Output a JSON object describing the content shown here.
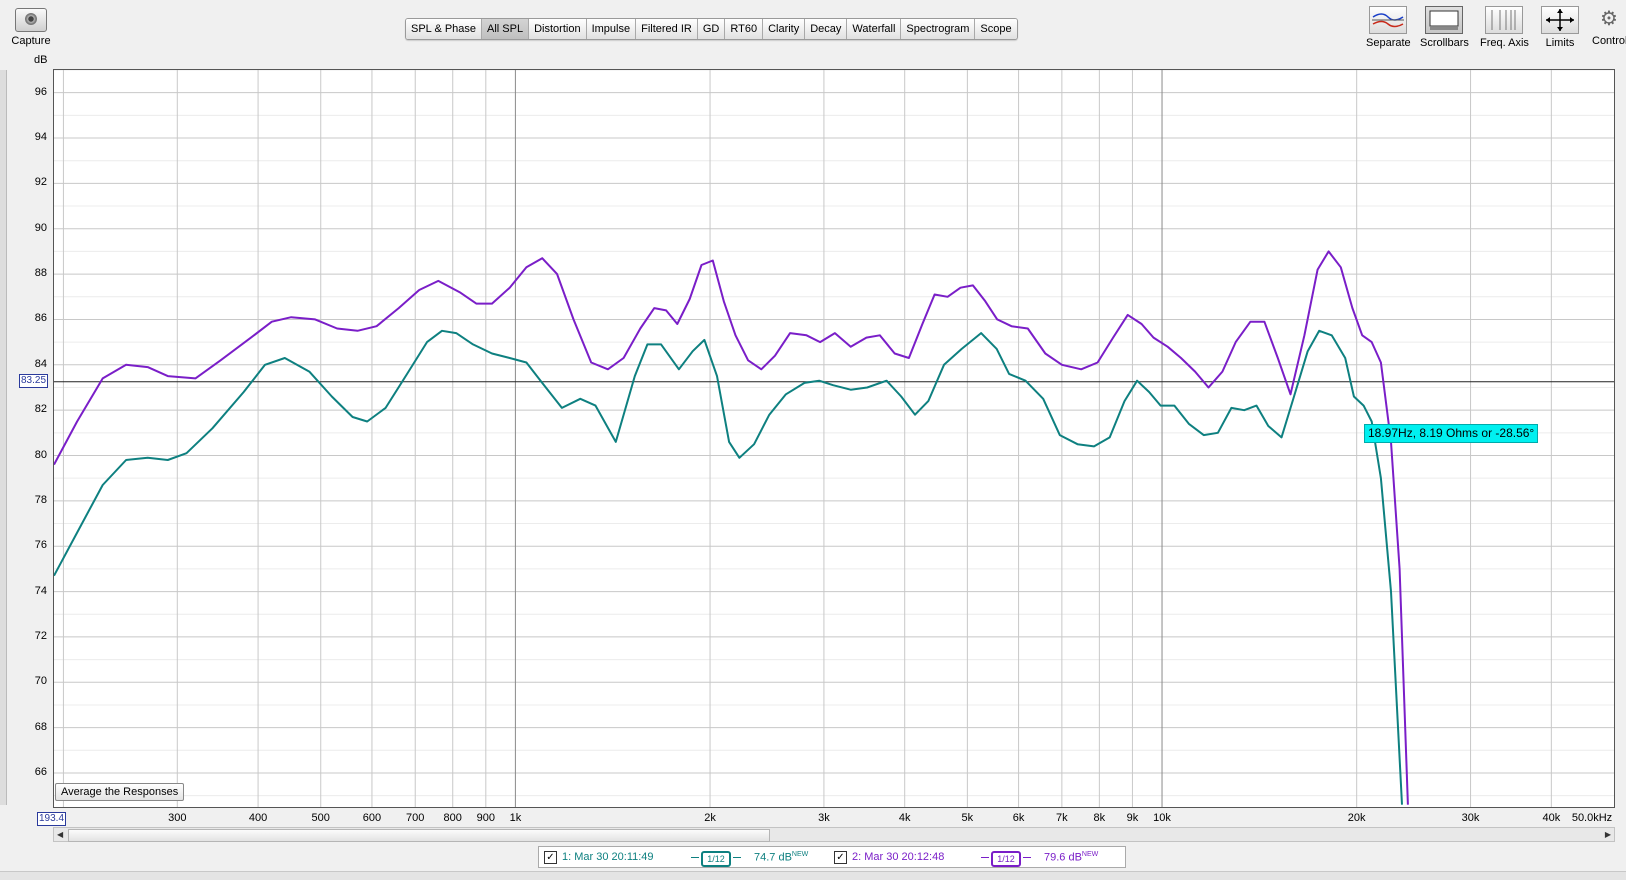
{
  "toolbar": {
    "capture_label": "Capture",
    "tabs": [
      "SPL & Phase",
      "All SPL",
      "Distortion",
      "Impulse",
      "Filtered IR",
      "GD",
      "RT60",
      "Clarity",
      "Decay",
      "Waterfall",
      "Spectrogram",
      "Scope"
    ],
    "active_tab": "All SPL",
    "tools": [
      "Separate",
      "Scrollbars",
      "Freq. Axis",
      "Limits",
      "Controls"
    ]
  },
  "plot": {
    "y_unit": "dB",
    "y_ticks": [
      "96",
      "94",
      "92",
      "90",
      "88",
      "86",
      "84",
      "82",
      "80",
      "78",
      "76",
      "74",
      "72",
      "70",
      "68",
      "66"
    ],
    "x_ticks": [
      {
        "v": 300,
        "t": "300"
      },
      {
        "v": 400,
        "t": "400"
      },
      {
        "v": 500,
        "t": "500"
      },
      {
        "v": 600,
        "t": "600"
      },
      {
        "v": 700,
        "t": "700"
      },
      {
        "v": 800,
        "t": "800"
      },
      {
        "v": 900,
        "t": "900"
      },
      {
        "v": 1000,
        "t": "1k"
      },
      {
        "v": 2000,
        "t": "2k"
      },
      {
        "v": 3000,
        "t": "3k"
      },
      {
        "v": 4000,
        "t": "4k"
      },
      {
        "v": 5000,
        "t": "5k"
      },
      {
        "v": 6000,
        "t": "6k"
      },
      {
        "v": 7000,
        "t": "7k"
      },
      {
        "v": 8000,
        "t": "8k"
      },
      {
        "v": 9000,
        "t": "9k"
      },
      {
        "v": 10000,
        "t": "10k"
      },
      {
        "v": 20000,
        "t": "20k"
      },
      {
        "v": 30000,
        "t": "30k"
      },
      {
        "v": 40000,
        "t": "40k"
      },
      {
        "v": 50000,
        "t": "50.0kHz"
      }
    ],
    "x_range": [
      193.4,
      50000
    ],
    "y_range": [
      64.5,
      97
    ],
    "cursor_y": "83.25",
    "cursor_x": "193.4",
    "tooltip": "18.97Hz, 8.19 Ohms or -28.56°",
    "avg_button": "Average the Responses"
  },
  "chart_data": {
    "type": "line",
    "xscale": "log",
    "ylim": [
      64.5,
      97
    ],
    "series": [
      {
        "name": "1: Mar 30 20:11:49",
        "color": "#0e8080",
        "points": [
          [
            193.4,
            74.7
          ],
          [
            210,
            76.6
          ],
          [
            230,
            78.7
          ],
          [
            250,
            79.8
          ],
          [
            270,
            79.9
          ],
          [
            290,
            79.8
          ],
          [
            310,
            80.1
          ],
          [
            340,
            81.2
          ],
          [
            380,
            82.8
          ],
          [
            410,
            84.0
          ],
          [
            440,
            84.3
          ],
          [
            480,
            83.7
          ],
          [
            520,
            82.6
          ],
          [
            560,
            81.7
          ],
          [
            590,
            81.5
          ],
          [
            630,
            82.1
          ],
          [
            680,
            83.6
          ],
          [
            730,
            85.0
          ],
          [
            770,
            85.5
          ],
          [
            810,
            85.4
          ],
          [
            860,
            84.9
          ],
          [
            920,
            84.5
          ],
          [
            980,
            84.3
          ],
          [
            1040,
            84.1
          ],
          [
            1100,
            83.2
          ],
          [
            1180,
            82.1
          ],
          [
            1260,
            82.5
          ],
          [
            1330,
            82.2
          ],
          [
            1430,
            80.6
          ],
          [
            1530,
            83.5
          ],
          [
            1600,
            84.9
          ],
          [
            1680,
            84.9
          ],
          [
            1790,
            83.8
          ],
          [
            1880,
            84.6
          ],
          [
            1960,
            85.1
          ],
          [
            2050,
            83.5
          ],
          [
            2140,
            80.6
          ],
          [
            2220,
            79.9
          ],
          [
            2340,
            80.5
          ],
          [
            2470,
            81.8
          ],
          [
            2620,
            82.7
          ],
          [
            2800,
            83.2
          ],
          [
            2950,
            83.3
          ],
          [
            3100,
            83.1
          ],
          [
            3300,
            82.9
          ],
          [
            3500,
            83.0
          ],
          [
            3750,
            83.3
          ],
          [
            3950,
            82.6
          ],
          [
            4150,
            81.8
          ],
          [
            4350,
            82.4
          ],
          [
            4600,
            84.0
          ],
          [
            4900,
            84.7
          ],
          [
            5250,
            85.4
          ],
          [
            5550,
            84.7
          ],
          [
            5800,
            83.6
          ],
          [
            6150,
            83.3
          ],
          [
            6550,
            82.5
          ],
          [
            6950,
            80.9
          ],
          [
            7400,
            80.5
          ],
          [
            7850,
            80.4
          ],
          [
            8300,
            80.8
          ],
          [
            8750,
            82.4
          ],
          [
            9150,
            83.3
          ],
          [
            9550,
            82.8
          ],
          [
            9950,
            82.2
          ],
          [
            10450,
            82.2
          ],
          [
            11000,
            81.4
          ],
          [
            11600,
            80.9
          ],
          [
            12200,
            81.0
          ],
          [
            12800,
            82.1
          ],
          [
            13400,
            82.0
          ],
          [
            14000,
            82.2
          ],
          [
            14600,
            81.3
          ],
          [
            15300,
            80.8
          ],
          [
            16000,
            82.6
          ],
          [
            16800,
            84.6
          ],
          [
            17500,
            85.5
          ],
          [
            18300,
            85.3
          ],
          [
            19200,
            84.3
          ],
          [
            19800,
            82.6
          ],
          [
            20500,
            82.2
          ],
          [
            21100,
            81.5
          ],
          [
            21800,
            79.0
          ],
          [
            22600,
            74.0
          ],
          [
            23500,
            64.6
          ]
        ]
      },
      {
        "name": "2: Mar 30 20:12:48",
        "color": "#7a1ec8",
        "points": [
          [
            193.4,
            79.6
          ],
          [
            210,
            81.5
          ],
          [
            230,
            83.4
          ],
          [
            250,
            84.0
          ],
          [
            270,
            83.9
          ],
          [
            290,
            83.5
          ],
          [
            320,
            83.4
          ],
          [
            350,
            84.2
          ],
          [
            390,
            85.2
          ],
          [
            420,
            85.9
          ],
          [
            450,
            86.1
          ],
          [
            490,
            86.0
          ],
          [
            530,
            85.6
          ],
          [
            570,
            85.5
          ],
          [
            610,
            85.7
          ],
          [
            660,
            86.5
          ],
          [
            710,
            87.3
          ],
          [
            760,
            87.7
          ],
          [
            820,
            87.2
          ],
          [
            870,
            86.7
          ],
          [
            920,
            86.7
          ],
          [
            980,
            87.4
          ],
          [
            1040,
            88.3
          ],
          [
            1100,
            88.7
          ],
          [
            1160,
            88.0
          ],
          [
            1230,
            86.0
          ],
          [
            1310,
            84.1
          ],
          [
            1390,
            83.8
          ],
          [
            1470,
            84.3
          ],
          [
            1560,
            85.6
          ],
          [
            1640,
            86.5
          ],
          [
            1710,
            86.4
          ],
          [
            1780,
            85.8
          ],
          [
            1860,
            86.9
          ],
          [
            1940,
            88.4
          ],
          [
            2020,
            88.6
          ],
          [
            2100,
            86.8
          ],
          [
            2190,
            85.3
          ],
          [
            2290,
            84.2
          ],
          [
            2400,
            83.8
          ],
          [
            2520,
            84.4
          ],
          [
            2660,
            85.4
          ],
          [
            2820,
            85.3
          ],
          [
            2960,
            85.0
          ],
          [
            3120,
            85.4
          ],
          [
            3300,
            84.8
          ],
          [
            3490,
            85.2
          ],
          [
            3660,
            85.3
          ],
          [
            3860,
            84.5
          ],
          [
            4060,
            84.3
          ],
          [
            4260,
            85.8
          ],
          [
            4450,
            87.1
          ],
          [
            4660,
            87.0
          ],
          [
            4880,
            87.4
          ],
          [
            5100,
            87.5
          ],
          [
            5330,
            86.8
          ],
          [
            5560,
            86.0
          ],
          [
            5850,
            85.7
          ],
          [
            6200,
            85.6
          ],
          [
            6600,
            84.5
          ],
          [
            7000,
            84.0
          ],
          [
            7500,
            83.8
          ],
          [
            7950,
            84.1
          ],
          [
            8400,
            85.2
          ],
          [
            8850,
            86.2
          ],
          [
            9300,
            85.8
          ],
          [
            9700,
            85.2
          ],
          [
            10200,
            84.8
          ],
          [
            10700,
            84.3
          ],
          [
            11250,
            83.7
          ],
          [
            11800,
            83.0
          ],
          [
            12400,
            83.7
          ],
          [
            13000,
            85.0
          ],
          [
            13700,
            85.9
          ],
          [
            14400,
            85.9
          ],
          [
            15100,
            84.3
          ],
          [
            15800,
            82.7
          ],
          [
            16600,
            85.3
          ],
          [
            17400,
            88.2
          ],
          [
            18100,
            89.0
          ],
          [
            18900,
            88.3
          ],
          [
            19700,
            86.5
          ],
          [
            20400,
            85.3
          ],
          [
            21100,
            85.0
          ],
          [
            21800,
            84.1
          ],
          [
            22600,
            80.6
          ],
          [
            23300,
            75.0
          ],
          [
            24000,
            64.6
          ]
        ]
      }
    ]
  },
  "legend": {
    "items": [
      {
        "label": "1: Mar 30 20:11:49",
        "smooth": "1/12",
        "level": "74.7 dB",
        "tag": "NEW",
        "color": "#0e8080"
      },
      {
        "label": "2: Mar 30 20:12:48",
        "smooth": "1/12",
        "level": "79.6 dB",
        "tag": "NEW",
        "color": "#7a1ec8"
      }
    ]
  }
}
